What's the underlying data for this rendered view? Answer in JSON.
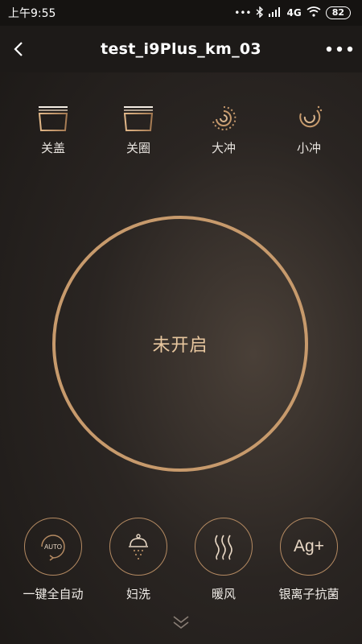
{
  "statusbar": {
    "time": "上午9:55",
    "network": "4G",
    "battery": "82"
  },
  "header": {
    "title": "test_i9Plus_km_03"
  },
  "top_modes": [
    {
      "label": "关盖",
      "icon": "lid-icon"
    },
    {
      "label": "关圈",
      "icon": "seat-ring-icon"
    },
    {
      "label": "大冲",
      "icon": "big-flush-icon"
    },
    {
      "label": "小冲",
      "icon": "small-flush-icon"
    }
  ],
  "main": {
    "status_text": "未开启"
  },
  "bottom_modes": [
    {
      "label": "一键全自动",
      "icon_text": "AUTO",
      "icon": "auto-icon"
    },
    {
      "label": "妇洗",
      "icon": "feminine-wash-icon"
    },
    {
      "label": "暖风",
      "icon": "warm-air-icon"
    },
    {
      "label": "银离子抗菌",
      "icon_text": "Ag+",
      "icon": "silver-ion-icon"
    }
  ],
  "colors": {
    "accent": "#c79a6c",
    "ring_text": "#e8c79f",
    "header_bg": "#1d1a18"
  }
}
